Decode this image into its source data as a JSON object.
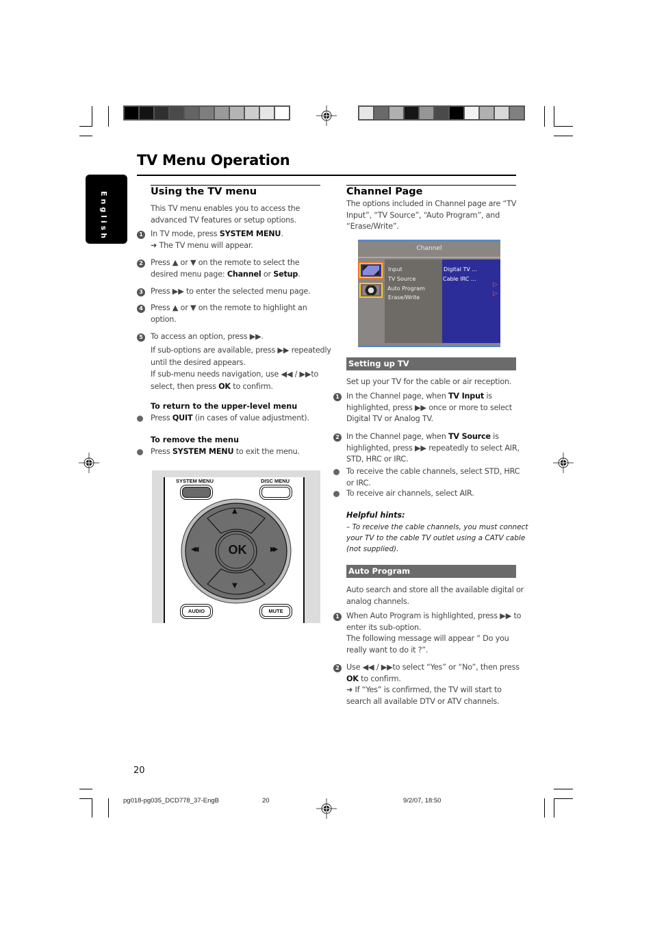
{
  "colors": {
    "swatches_left": [
      "#000000",
      "#141414",
      "#303030",
      "#4a4a4a",
      "#646464",
      "#7e7e7e",
      "#9a9a9a",
      "#b4b4b4",
      "#cecece",
      "#e6e6e6",
      "#ffffff"
    ],
    "swatches_right": [
      "#e6e6e6",
      "#6a6a6a",
      "#b0b0b0",
      "#161616",
      "#969696",
      "#4a4a4a",
      "#000000",
      "#f2f2f2",
      "#b0b0b0",
      "#d8d8d8",
      "#808080"
    ],
    "section_bar": "#6b6b6b",
    "screen_blue": "#2d2d9a"
  },
  "page": {
    "title": "TV Menu Operation",
    "language_tab": "English",
    "page_number": "20"
  },
  "left": {
    "heading": "Using the TV menu",
    "intro": [
      "This TV menu enables you to access the",
      "advanced TV features or setup options."
    ],
    "steps": [
      {
        "num": "1",
        "lines": [
          "In TV mode, press <b>SYSTEM MENU</b>.",
          "➜ The TV menu will appear."
        ]
      },
      {
        "num": "2",
        "lines": [
          "Press ▲ or ▼  on the remote to select the",
          "desired menu page: <b>Channel</b> or <b>Setup</b>."
        ]
      },
      {
        "num": "3",
        "lines": [
          "Press ▶▶  to enter the selected menu page."
        ]
      },
      {
        "num": "4",
        "lines": [
          "Press ▲ or ▼ on the remote to highlight an",
          "option."
        ]
      },
      {
        "num": "5",
        "lines": [
          "To access an option, press ▶▶."
        ]
      }
    ],
    "step5_extra": [
      "If sub-options are available, press ▶▶  repeatedly",
      "until the desired appears.",
      "If sub-menu needs navigation, use ◀◀ /    ▶▶to",
      "select, then press <b>OK</b> to confirm."
    ],
    "return_heading": "To return to the upper-level menu",
    "return_text": "Press <b>QUIT</b>  (in cases of value adjustment).",
    "remove_heading": "To remove the menu",
    "remove_text": "Press <b>SYSTEM MENU</b> to exit the menu."
  },
  "remote": {
    "system_menu": "SYSTEM MENU",
    "disc_menu": "DISC MENU",
    "ok": "OK",
    "up": "▲",
    "down": "▼",
    "prev": "◀◀",
    "next": "▶▶",
    "audio": "AUDIO",
    "mute": "MUTE"
  },
  "right": {
    "heading": "Channel Page",
    "intro": [
      "The options included in Channel page are “TV",
      "Input”, “TV Source”, “Auto Program”,  and",
      "“Erase/Write”."
    ],
    "screen": {
      "title": "Channel",
      "items": [
        "Input",
        "TV Source",
        "Auto Program",
        "Erase/Write"
      ],
      "values": [
        "Digital  TV  ...",
        "Cable IRC  ..."
      ]
    },
    "setup_bar": "Setting up TV",
    "setup_intro": "Set up your TV for the cable or air reception.",
    "setup_steps": [
      {
        "num": "1",
        "lines": [
          "In the Channel page, when <b>TV Input</b> is",
          "highlighted, press ▶▶  once or more to select",
          "Digital TV or Analog TV."
        ]
      },
      {
        "num": "2",
        "lines": [
          "In the Channel page, when <b>TV Source</b> is",
          "highlighted, press ▶▶  repeatedly to select AIR,",
          "STD, HRC or IRC."
        ]
      }
    ],
    "bullets": [
      [
        "To receive the cable channels, select STD, HRC",
        "or IRC."
      ],
      [
        "To receive air channels, select AIR."
      ]
    ],
    "hints_title": "Helpful hints:",
    "hints_lines": [
      "–  To receive the cable channels,  you must connect",
      "your TV to the cable TV outlet using a CATV cable",
      "(not supplied)."
    ],
    "auto_bar": "Auto Program",
    "auto_intro": [
      "Auto search and store all the available digital or",
      "analog channels."
    ],
    "auto_steps": [
      {
        "num": "1",
        "lines": [
          "When Auto Program is highlighted, press ▶▶  to",
          "enter its sub-option.",
          "The following message will appear “ Do you",
          "really want to do it ?”."
        ]
      },
      {
        "num": "2",
        "lines": [
          "Use ◀◀ /    ▶▶to select “Yes” or “No”, then press",
          "<b>OK</b> to confirm.",
          "➜ If “Yes” is confirmed, the TV will start to",
          "search all available DTV or ATV channels."
        ]
      }
    ]
  },
  "footer": {
    "file": "pg018-pg035_DCD778_37-EngB",
    "page": "20",
    "date": "9/2/07, 18:50"
  }
}
